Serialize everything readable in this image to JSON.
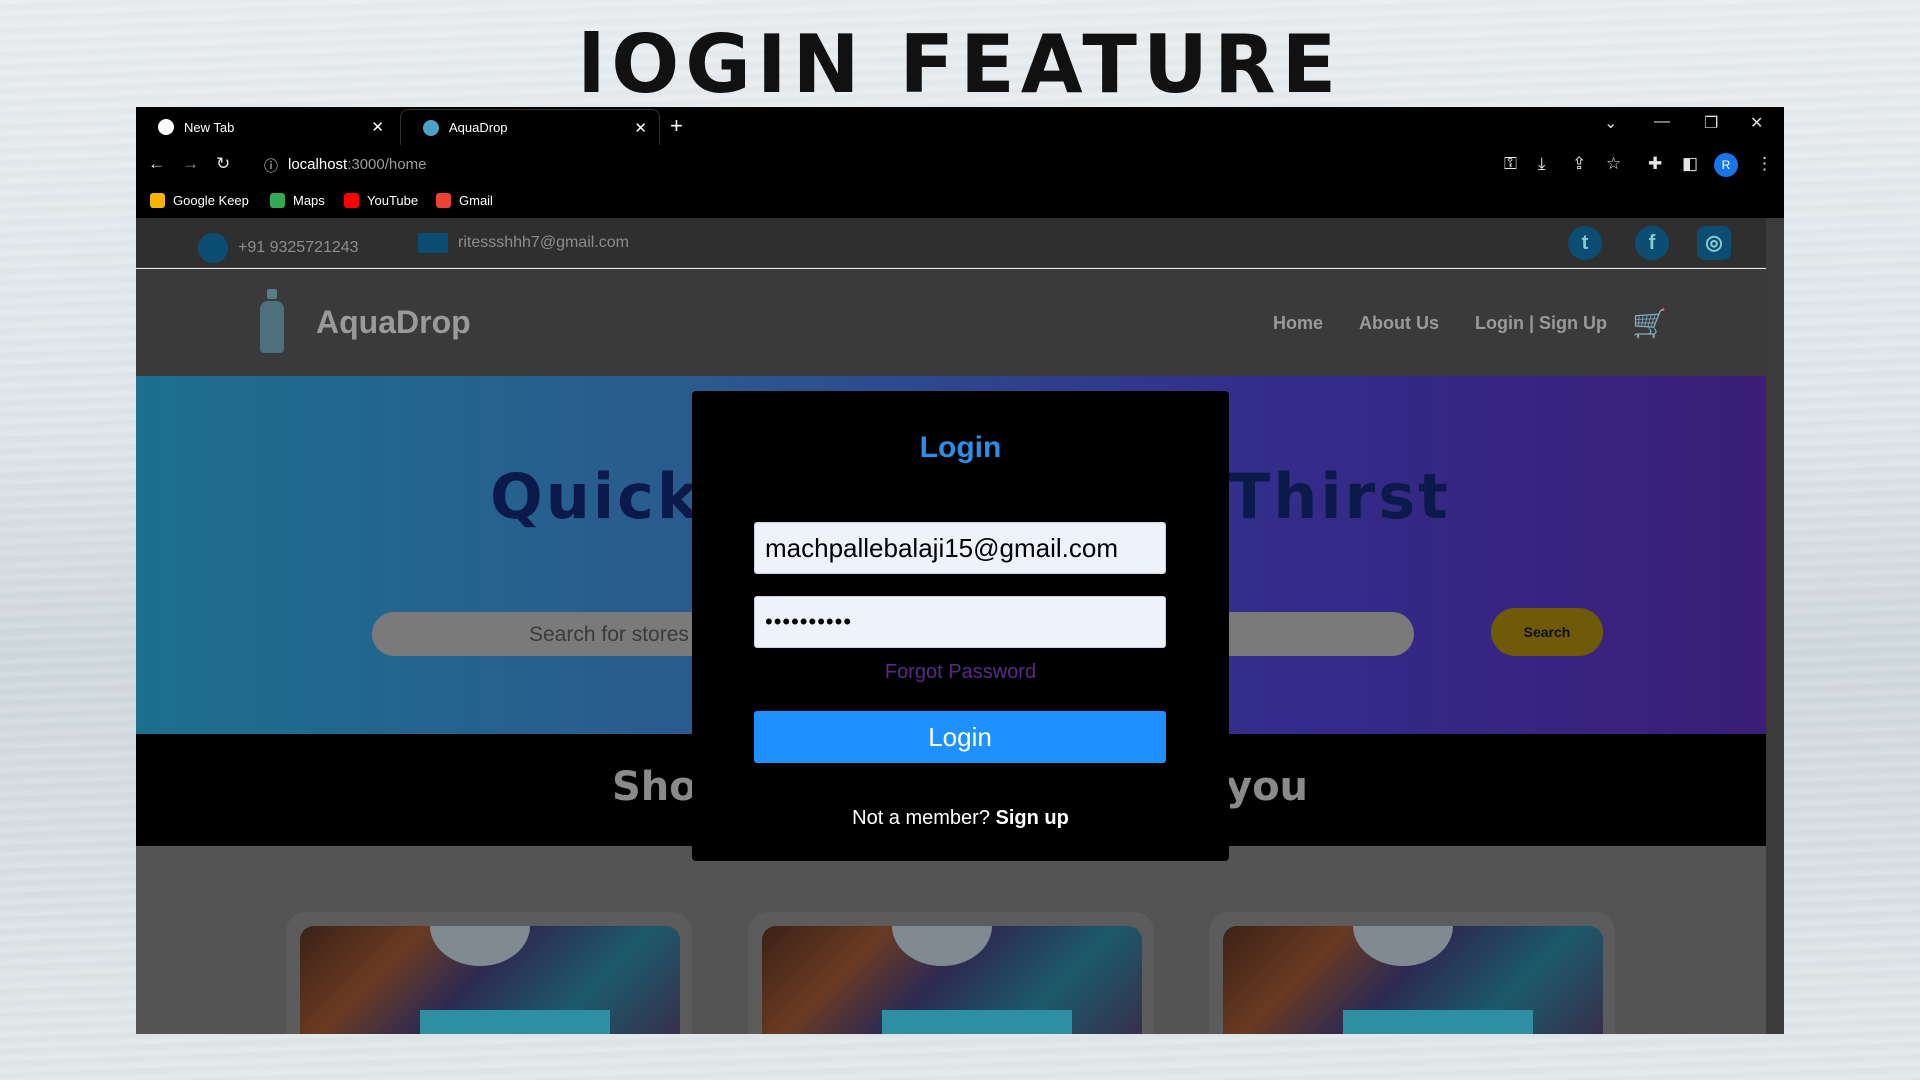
{
  "slide_title": "lOGIN FEATURE",
  "browser": {
    "tabs": [
      {
        "label": "New Tab",
        "close": "✕"
      },
      {
        "label": "AquaDrop",
        "close": "✕"
      }
    ],
    "new_tab": "+",
    "url_host": "localhost",
    "url_path": ":3000/home",
    "profile_initial": "R",
    "bookmarks": [
      "Google Keep",
      "Maps",
      "YouTube",
      "Gmail"
    ]
  },
  "site": {
    "phone": "+91 9325721243",
    "email": "ritessshhh7@gmail.com",
    "brand": "AquaDrop",
    "nav": {
      "home": "Home",
      "about": "About Us",
      "login": "Login | Sign Up"
    },
    "hero_left": "Quick",
    "hero_right": "Thirst",
    "search_placeholder": "Search for stores",
    "search_button": "Search",
    "band_left": "Shop",
    "band_right": "you"
  },
  "modal": {
    "title": "Login",
    "email_value": "machpallebalaji15@gmail.com",
    "password_value": "••••••••••",
    "forgot": "Forgot Password",
    "login_button": "Login",
    "not_member": "Not a member?",
    "sign_up": "Sign up"
  },
  "colors": {
    "accent": "#1e90ff",
    "title": "#2a8fe8",
    "search_button": "#6e5a08"
  }
}
